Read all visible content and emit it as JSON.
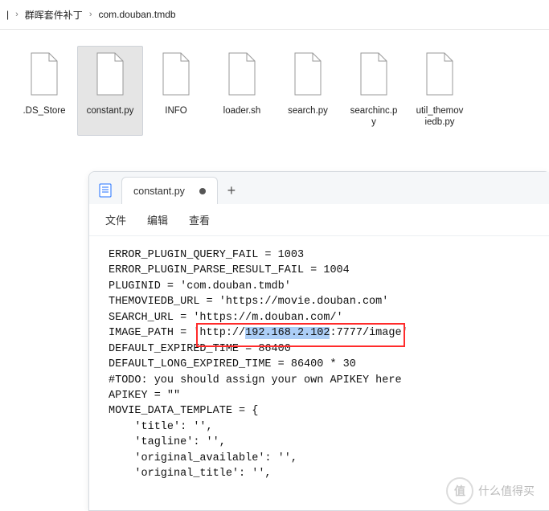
{
  "breadcrumb": {
    "part0_suffix": "|",
    "part1": "群晖套件补丁",
    "part2": "com.douban.tmdb"
  },
  "files": [
    {
      "label": ".DS_Store",
      "selected": false
    },
    {
      "label": "constant.py",
      "selected": true
    },
    {
      "label": "INFO",
      "selected": false
    },
    {
      "label": "loader.sh",
      "selected": false
    },
    {
      "label": "search.py",
      "selected": false
    },
    {
      "label": "searchinc.p\ny",
      "selected": false
    },
    {
      "label": "util_themov\niedb.py",
      "selected": false
    }
  ],
  "editor": {
    "tab_title": "constant.py",
    "menus": {
      "file": "文件",
      "edit": "编辑",
      "view": "查看"
    },
    "highlight_ip": "192.168.2.102",
    "lines": [
      "ERROR_PLUGIN_QUERY_FAIL = 1003",
      "ERROR_PLUGIN_PARSE_RESULT_FAIL = 1004",
      "",
      "PLUGINID = 'com.douban.tmdb'",
      "THEMOVIEDB_URL = 'https://movie.douban.com'",
      "SEARCH_URL = 'https://m.douban.com/'",
      "IMAGE_PATH = 'http://192.168.2.102:7777/image'",
      "DEFAULT_EXPIRED_TIME = 86400",
      "DEFAULT_LONG_EXPIRED_TIME = 86400 * 30",
      "#TODO: you should assign your own APIKEY here",
      "APIKEY = \"\"",
      "",
      "MOVIE_DATA_TEMPLATE = {",
      "    'title': '',",
      "    'tagline': '',",
      "    'original_available': '',",
      "    'original_title': '',"
    ]
  },
  "watermark": {
    "text": "什么值得买",
    "badge": "值"
  }
}
